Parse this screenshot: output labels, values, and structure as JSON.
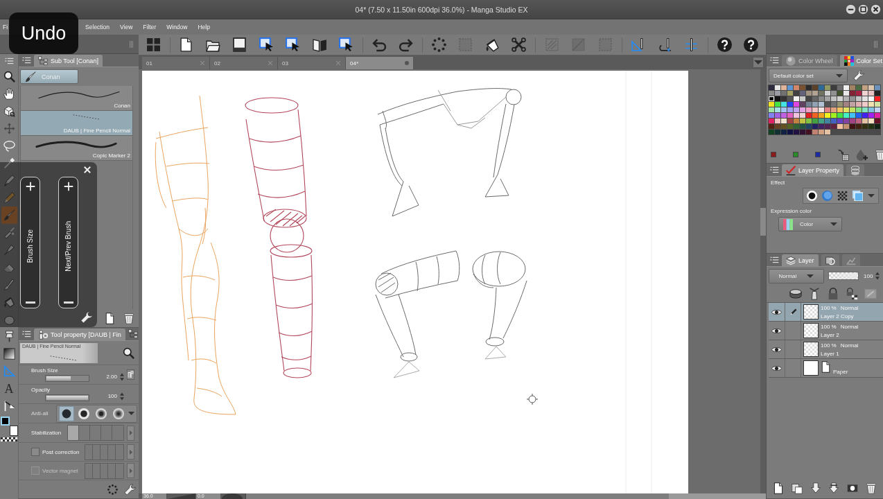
{
  "window": {
    "title": "04* (7.50 x 11.50in 600dpi 36.0%) - Manga Studio EX"
  },
  "shortcut_notice": {
    "label": "Undo"
  },
  "menu": [
    {
      "label": "Fi"
    },
    {
      "label": "Selection"
    },
    {
      "label": "View"
    },
    {
      "label": "Filter"
    },
    {
      "label": "Window"
    },
    {
      "label": "Help"
    }
  ],
  "toolbar": {
    "groups": [
      [
        {
          "disabled": false
        }
      ],
      [
        {
          "disabled": false
        },
        {
          "disabled": false
        },
        {
          "disabled": false
        },
        {
          "disabled": false
        },
        {
          "disabled": false
        },
        {
          "disabled": false
        },
        {
          "disabled": false
        }
      ],
      [
        {
          "disabled": false
        },
        {
          "disabled": false
        }
      ],
      [
        {
          "disabled": false
        },
        {
          "disabled": true
        },
        {
          "disabled": false
        },
        {
          "disabled": false
        }
      ],
      [
        {
          "disabled": true
        },
        {
          "disabled": true
        },
        {
          "disabled": true
        }
      ],
      [
        {
          "disabled": false
        },
        {
          "disabled": false
        },
        {
          "disabled": false
        }
      ],
      [
        {
          "disabled": false
        },
        {
          "disabled": false
        }
      ]
    ]
  },
  "document_tabs": [
    {
      "label": "01",
      "selected": false
    },
    {
      "label": "02",
      "selected": false
    },
    {
      "label": "03",
      "selected": false
    },
    {
      "label": "04*",
      "selected": true
    }
  ],
  "tools": {
    "items": [
      {
        "selected": false
      },
      {
        "selected": false
      },
      {
        "selected": false
      },
      {
        "selected": false
      },
      {
        "selected": false
      },
      {
        "selected": false
      },
      {
        "selected": false
      },
      {
        "selected": false
      },
      {
        "selected": true
      },
      {
        "selected": false
      },
      {
        "selected": false
      },
      {
        "selected": false
      },
      {
        "selected": false
      },
      {
        "selected": false
      },
      {
        "selected": false
      },
      {
        "selected": false
      },
      {
        "selected": false
      },
      {
        "selected": false
      },
      {
        "selected": false,
        "glyph": "A"
      },
      {
        "selected": false
      }
    ]
  },
  "colors": [
    {
      "color": "#000000",
      "selected": true
    },
    {
      "color": "#ffffff",
      "selected": false
    }
  ],
  "sub_tool": {
    "title": "Sub Tool [Conan]",
    "groups": [
      {
        "label": "Conan",
        "selected": true
      }
    ],
    "brushes": [
      {
        "name": "Conan",
        "kind": "pen",
        "selected": false
      },
      {
        "name": "DAUB | Fine Pencil Normal",
        "kind": "pencil",
        "selected": true
      },
      {
        "name": "Copic Marker 2",
        "kind": "marker",
        "selected": false
      }
    ]
  },
  "quick_controls": [
    {
      "label": "Brush Size"
    },
    {
      "label": "Next/Prev Brush"
    }
  ],
  "tool_property": {
    "title": "Tool property [DAUB | Fin",
    "preview_label": "DAUB | Fine Pencil Normal",
    "settings": [
      {
        "kind": "slider",
        "label": "Brush Size",
        "value": "2.00",
        "level": 0.58,
        "pressure": true
      },
      {
        "kind": "slider",
        "label": "Opacity",
        "value": "100",
        "level": 1,
        "pressure": false
      },
      {
        "kind": "choice",
        "label": "Anti-ali",
        "options": [
          {
            "selected": true
          },
          {
            "selected": false
          },
          {
            "selected": false
          },
          {
            "selected": false
          }
        ]
      },
      {
        "kind": "steps",
        "label": "Stabilization",
        "level": 0.2
      },
      {
        "kind": "check",
        "label": "Post correction",
        "checked": false,
        "disabled": false
      },
      {
        "kind": "check",
        "label": "Vector magnet",
        "checked": false,
        "disabled": true
      }
    ]
  },
  "color_set": {
    "tabs": [
      {
        "label": "Color Wheel",
        "selected": false
      },
      {
        "label": "Color Set",
        "selected": true
      }
    ],
    "set_name": "Default color set",
    "swatches": [
      {
        "color": "#2b2b40",
        "selected": false
      },
      {
        "color": "#e6e6e6",
        "selected": false
      },
      {
        "color": "#e2b49a",
        "selected": false
      },
      {
        "color": "#5e98d4",
        "selected": false
      },
      {
        "color": "#d4866a",
        "selected": false
      },
      {
        "color": "#7a5232",
        "selected": false
      },
      {
        "color": "#2c2c2c",
        "selected": false
      },
      {
        "color": "#5c4028",
        "selected": false
      },
      {
        "color": "#2e6a98",
        "selected": false
      },
      {
        "color": "#8e9a62",
        "selected": false
      },
      {
        "color": "#3c3c3c",
        "selected": false
      },
      {
        "color": "#6c6c6c",
        "selected": false
      },
      {
        "color": "#f0f0f0",
        "selected": false
      },
      {
        "color": "#a28262",
        "selected": false
      },
      {
        "color": "#4c6a44",
        "selected": false
      },
      {
        "color": "#c2a282",
        "selected": false
      },
      {
        "color": "#dcc6b0",
        "selected": false
      },
      {
        "color": "#6a92ba",
        "selected": false
      },
      {
        "color": "#8a8a8a",
        "selected": false
      },
      {
        "color": "#9c9ca4",
        "selected": false
      },
      {
        "color": "#727272",
        "selected": false
      },
      {
        "color": "#a4a066",
        "selected": false
      },
      {
        "color": "#424242",
        "selected": false
      },
      {
        "color": "#62627a",
        "selected": false
      },
      {
        "color": "#a29282",
        "selected": false
      },
      {
        "color": "#b2a292",
        "selected": false
      },
      {
        "color": "#727262",
        "selected": false
      },
      {
        "color": "#d2d2d2",
        "selected": false
      },
      {
        "color": "#929292",
        "selected": false
      },
      {
        "color": "#42522e",
        "selected": false
      },
      {
        "color": "#e8e8e8",
        "selected": false
      },
      {
        "color": "#822234",
        "selected": false
      },
      {
        "color": "#a42244",
        "selected": false
      },
      {
        "color": "#f0d2d2",
        "selected": false
      },
      {
        "color": "#e8c2c2",
        "selected": false
      },
      {
        "color": "#222222",
        "selected": false
      },
      {
        "color": "#000000",
        "selected": true
      },
      {
        "color": "#141414",
        "selected": false
      },
      {
        "color": "#333333",
        "selected": false
      },
      {
        "color": "#555555",
        "selected": false
      },
      {
        "color": "#f2f2f2",
        "selected": false
      },
      {
        "color": "#c8c8c8",
        "selected": false
      },
      {
        "color": "#444444",
        "selected": false
      },
      {
        "color": "#666666",
        "selected": false
      },
      {
        "color": "#888888",
        "selected": false
      },
      {
        "color": "#a2a2a2",
        "selected": false
      },
      {
        "color": "#c2c2c2",
        "selected": false
      },
      {
        "color": "#d2d2d2",
        "selected": false
      },
      {
        "color": "#b2b2b2",
        "selected": false
      },
      {
        "color": "#929292",
        "selected": false
      },
      {
        "color": "#c4c4c4",
        "selected": false
      },
      {
        "color": "#e2e2e2",
        "selected": false
      },
      {
        "color": "#f8f8f8",
        "selected": false
      },
      {
        "color": "#ff2222",
        "selected": false
      },
      {
        "color": "#f2e222",
        "selected": false
      },
      {
        "color": "#44e244",
        "selected": false
      },
      {
        "color": "#44e2e2",
        "selected": false
      },
      {
        "color": "#2244f2",
        "selected": false
      },
      {
        "color": "#e244e2",
        "selected": false
      },
      {
        "color": "#624262",
        "selected": false
      },
      {
        "color": "#728292",
        "selected": false
      },
      {
        "color": "#92a2b2",
        "selected": false
      },
      {
        "color": "#b2c2d2",
        "selected": false
      },
      {
        "color": "#525252",
        "selected": false
      },
      {
        "color": "#727272",
        "selected": false
      },
      {
        "color": "#929272",
        "selected": false
      },
      {
        "color": "#a28282",
        "selected": false
      },
      {
        "color": "#c2a2a2",
        "selected": false
      },
      {
        "color": "#e2b2b2",
        "selected": false
      },
      {
        "color": "#f2caca",
        "selected": false
      },
      {
        "color": "#f2e2b2",
        "selected": false
      },
      {
        "color": "#d2e2a2",
        "selected": false
      },
      {
        "color": "#a2e2a2",
        "selected": false
      },
      {
        "color": "#a2e2e2",
        "selected": false
      },
      {
        "color": "#a2c2f2",
        "selected": false
      },
      {
        "color": "#a2a2f2",
        "selected": false
      },
      {
        "color": "#c2a2f2",
        "selected": false
      },
      {
        "color": "#e2a2e2",
        "selected": false
      },
      {
        "color": "#f2a2c2",
        "selected": false
      },
      {
        "color": "#f2c2c2",
        "selected": false
      },
      {
        "color": "#f2e2e2",
        "selected": false
      },
      {
        "color": "#e28282",
        "selected": false
      },
      {
        "color": "#e2a282",
        "selected": false
      },
      {
        "color": "#f2c262",
        "selected": false
      },
      {
        "color": "#e2e262",
        "selected": false
      },
      {
        "color": "#c2e262",
        "selected": false
      },
      {
        "color": "#82e282",
        "selected": false
      },
      {
        "color": "#82e2c2",
        "selected": false
      },
      {
        "color": "#82c2e2",
        "selected": false
      },
      {
        "color": "#c2d2f2",
        "selected": false
      },
      {
        "color": "#8282f2",
        "selected": false
      },
      {
        "color": "#a262e2",
        "selected": false
      },
      {
        "color": "#c262e2",
        "selected": false
      },
      {
        "color": "#e262c2",
        "selected": false
      },
      {
        "color": "#f2c2e2",
        "selected": false
      },
      {
        "color": "#f2d2d2",
        "selected": false
      },
      {
        "color": "#e22222",
        "selected": false
      },
      {
        "color": "#f26222",
        "selected": false
      },
      {
        "color": "#f2a222",
        "selected": false
      },
      {
        "color": "#f2f222",
        "selected": false
      },
      {
        "color": "#a2f222",
        "selected": false
      },
      {
        "color": "#44e244",
        "selected": false
      },
      {
        "color": "#44f2c2",
        "selected": false
      },
      {
        "color": "#44c2f2",
        "selected": false
      },
      {
        "color": "#2262f2",
        "selected": false
      },
      {
        "color": "#4422f2",
        "selected": false
      },
      {
        "color": "#a222f2",
        "selected": false
      },
      {
        "color": "#e222a2",
        "selected": false
      },
      {
        "color": "#e22262",
        "selected": false
      },
      {
        "color": "#f2c2c2",
        "selected": false
      },
      {
        "color": "#f2e2d2",
        "selected": false
      },
      {
        "color": "#a24242",
        "selected": false
      },
      {
        "color": "#c28242",
        "selected": false
      },
      {
        "color": "#c2c242",
        "selected": false
      },
      {
        "color": "#82c242",
        "selected": false
      },
      {
        "color": "#42a242",
        "selected": false
      },
      {
        "color": "#42a282",
        "selected": false
      },
      {
        "color": "#4282a2",
        "selected": false
      },
      {
        "color": "#4262c2",
        "selected": false
      },
      {
        "color": "#6242c2",
        "selected": false
      },
      {
        "color": "#8242a2",
        "selected": false
      },
      {
        "color": "#a24282",
        "selected": false
      },
      {
        "color": "#c26282",
        "selected": false
      },
      {
        "color": "#e2c2a2",
        "selected": false
      },
      {
        "color": "#f2e2c2",
        "selected": false
      },
      {
        "color": "#621222",
        "selected": false
      },
      {
        "color": "#522212",
        "selected": false
      },
      {
        "color": "#624222",
        "selected": false
      },
      {
        "color": "#625222",
        "selected": false
      },
      {
        "color": "#526222",
        "selected": false
      },
      {
        "color": "#326232",
        "selected": false
      },
      {
        "color": "#225242",
        "selected": false
      },
      {
        "color": "#224262",
        "selected": false
      },
      {
        "color": "#222262",
        "selected": false
      },
      {
        "color": "#422262",
        "selected": false
      },
      {
        "color": "#522252",
        "selected": false
      },
      {
        "color": "#622242",
        "selected": false
      },
      {
        "color": "#f2c2a2",
        "selected": false
      },
      {
        "color": "#c29272",
        "selected": false
      },
      {
        "color": "#421212",
        "selected": false
      },
      {
        "color": "#422212",
        "selected": false
      },
      {
        "color": "#323212",
        "selected": false
      },
      {
        "color": "#223212",
        "selected": false
      },
      {
        "color": "#122212",
        "selected": false
      },
      {
        "color": "#124222",
        "selected": false
      },
      {
        "color": "#123232",
        "selected": false
      },
      {
        "color": "#122242",
        "selected": false
      },
      {
        "color": "#121242",
        "selected": false
      },
      {
        "color": "#221242",
        "selected": false
      },
      {
        "color": "#321232",
        "selected": false
      },
      {
        "color": "#421222",
        "selected": false
      },
      {
        "color": "#c28272",
        "selected": false
      },
      {
        "color": "#d2a282",
        "selected": false
      },
      {
        "color": "#e2c2a2",
        "selected": false
      }
    ],
    "recent": [
      {
        "color": "#8c1c1c"
      },
      {
        "color": "#2a8a2a"
      },
      {
        "color": "#1c2ca4"
      }
    ]
  },
  "layer_property": {
    "tabs": [
      {
        "label": "Layer Property",
        "selected": true
      },
      {
        "selected": false
      }
    ],
    "effect_label": "Effect",
    "expression_label": "Expression color",
    "expression_value": "Color"
  },
  "layer_panel": {
    "tabs": [
      {
        "label": "Layer",
        "selected": true
      },
      {
        "selected": false
      },
      {
        "selected": false
      }
    ],
    "blend_mode": "Normal",
    "opacity": {
      "level": 1,
      "reading": "100"
    }
  },
  "layers": [
    {
      "kind": "raster",
      "opacity": "100 %",
      "blend": "Normal",
      "name": "Layer 2 Copy",
      "visible": true,
      "target": true,
      "selected": true
    },
    {
      "kind": "raster",
      "opacity": "100 %",
      "blend": "Normal",
      "name": "Layer 2",
      "visible": true,
      "target": false,
      "selected": false
    },
    {
      "kind": "raster",
      "opacity": "100 %",
      "blend": "Normal",
      "name": "Layer 1",
      "visible": true,
      "target": false,
      "selected": false
    },
    {
      "kind": "paper",
      "name": "Paper",
      "visible": true,
      "target": false,
      "selected": false
    }
  ],
  "status_bar": {
    "zoom": "36.0",
    "rotation": "0.0"
  }
}
